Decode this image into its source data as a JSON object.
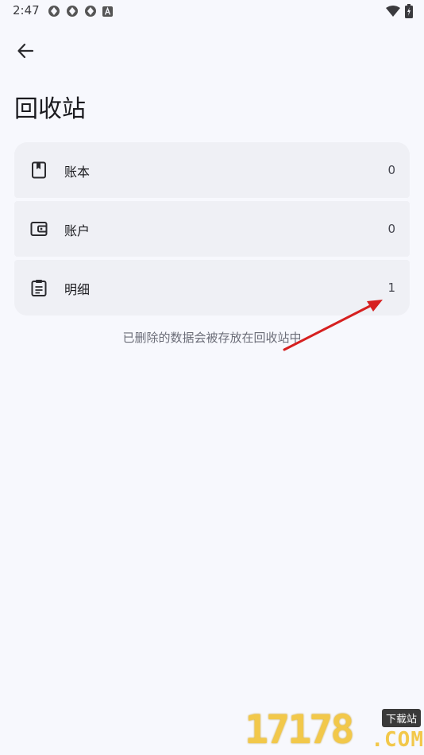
{
  "status": {
    "time": "2:47"
  },
  "header": {
    "title": "回收站"
  },
  "items": [
    {
      "label": "账本",
      "count": "0",
      "icon": "book-icon"
    },
    {
      "label": "账户",
      "count": "0",
      "icon": "wallet-icon"
    },
    {
      "label": "明细",
      "count": "1",
      "icon": "clipboard-icon"
    }
  ],
  "hint": "已删除的数据会被存放在回收站中",
  "watermark": {
    "digits": "17178",
    "badge": "下载站",
    "domain": ".COM"
  }
}
